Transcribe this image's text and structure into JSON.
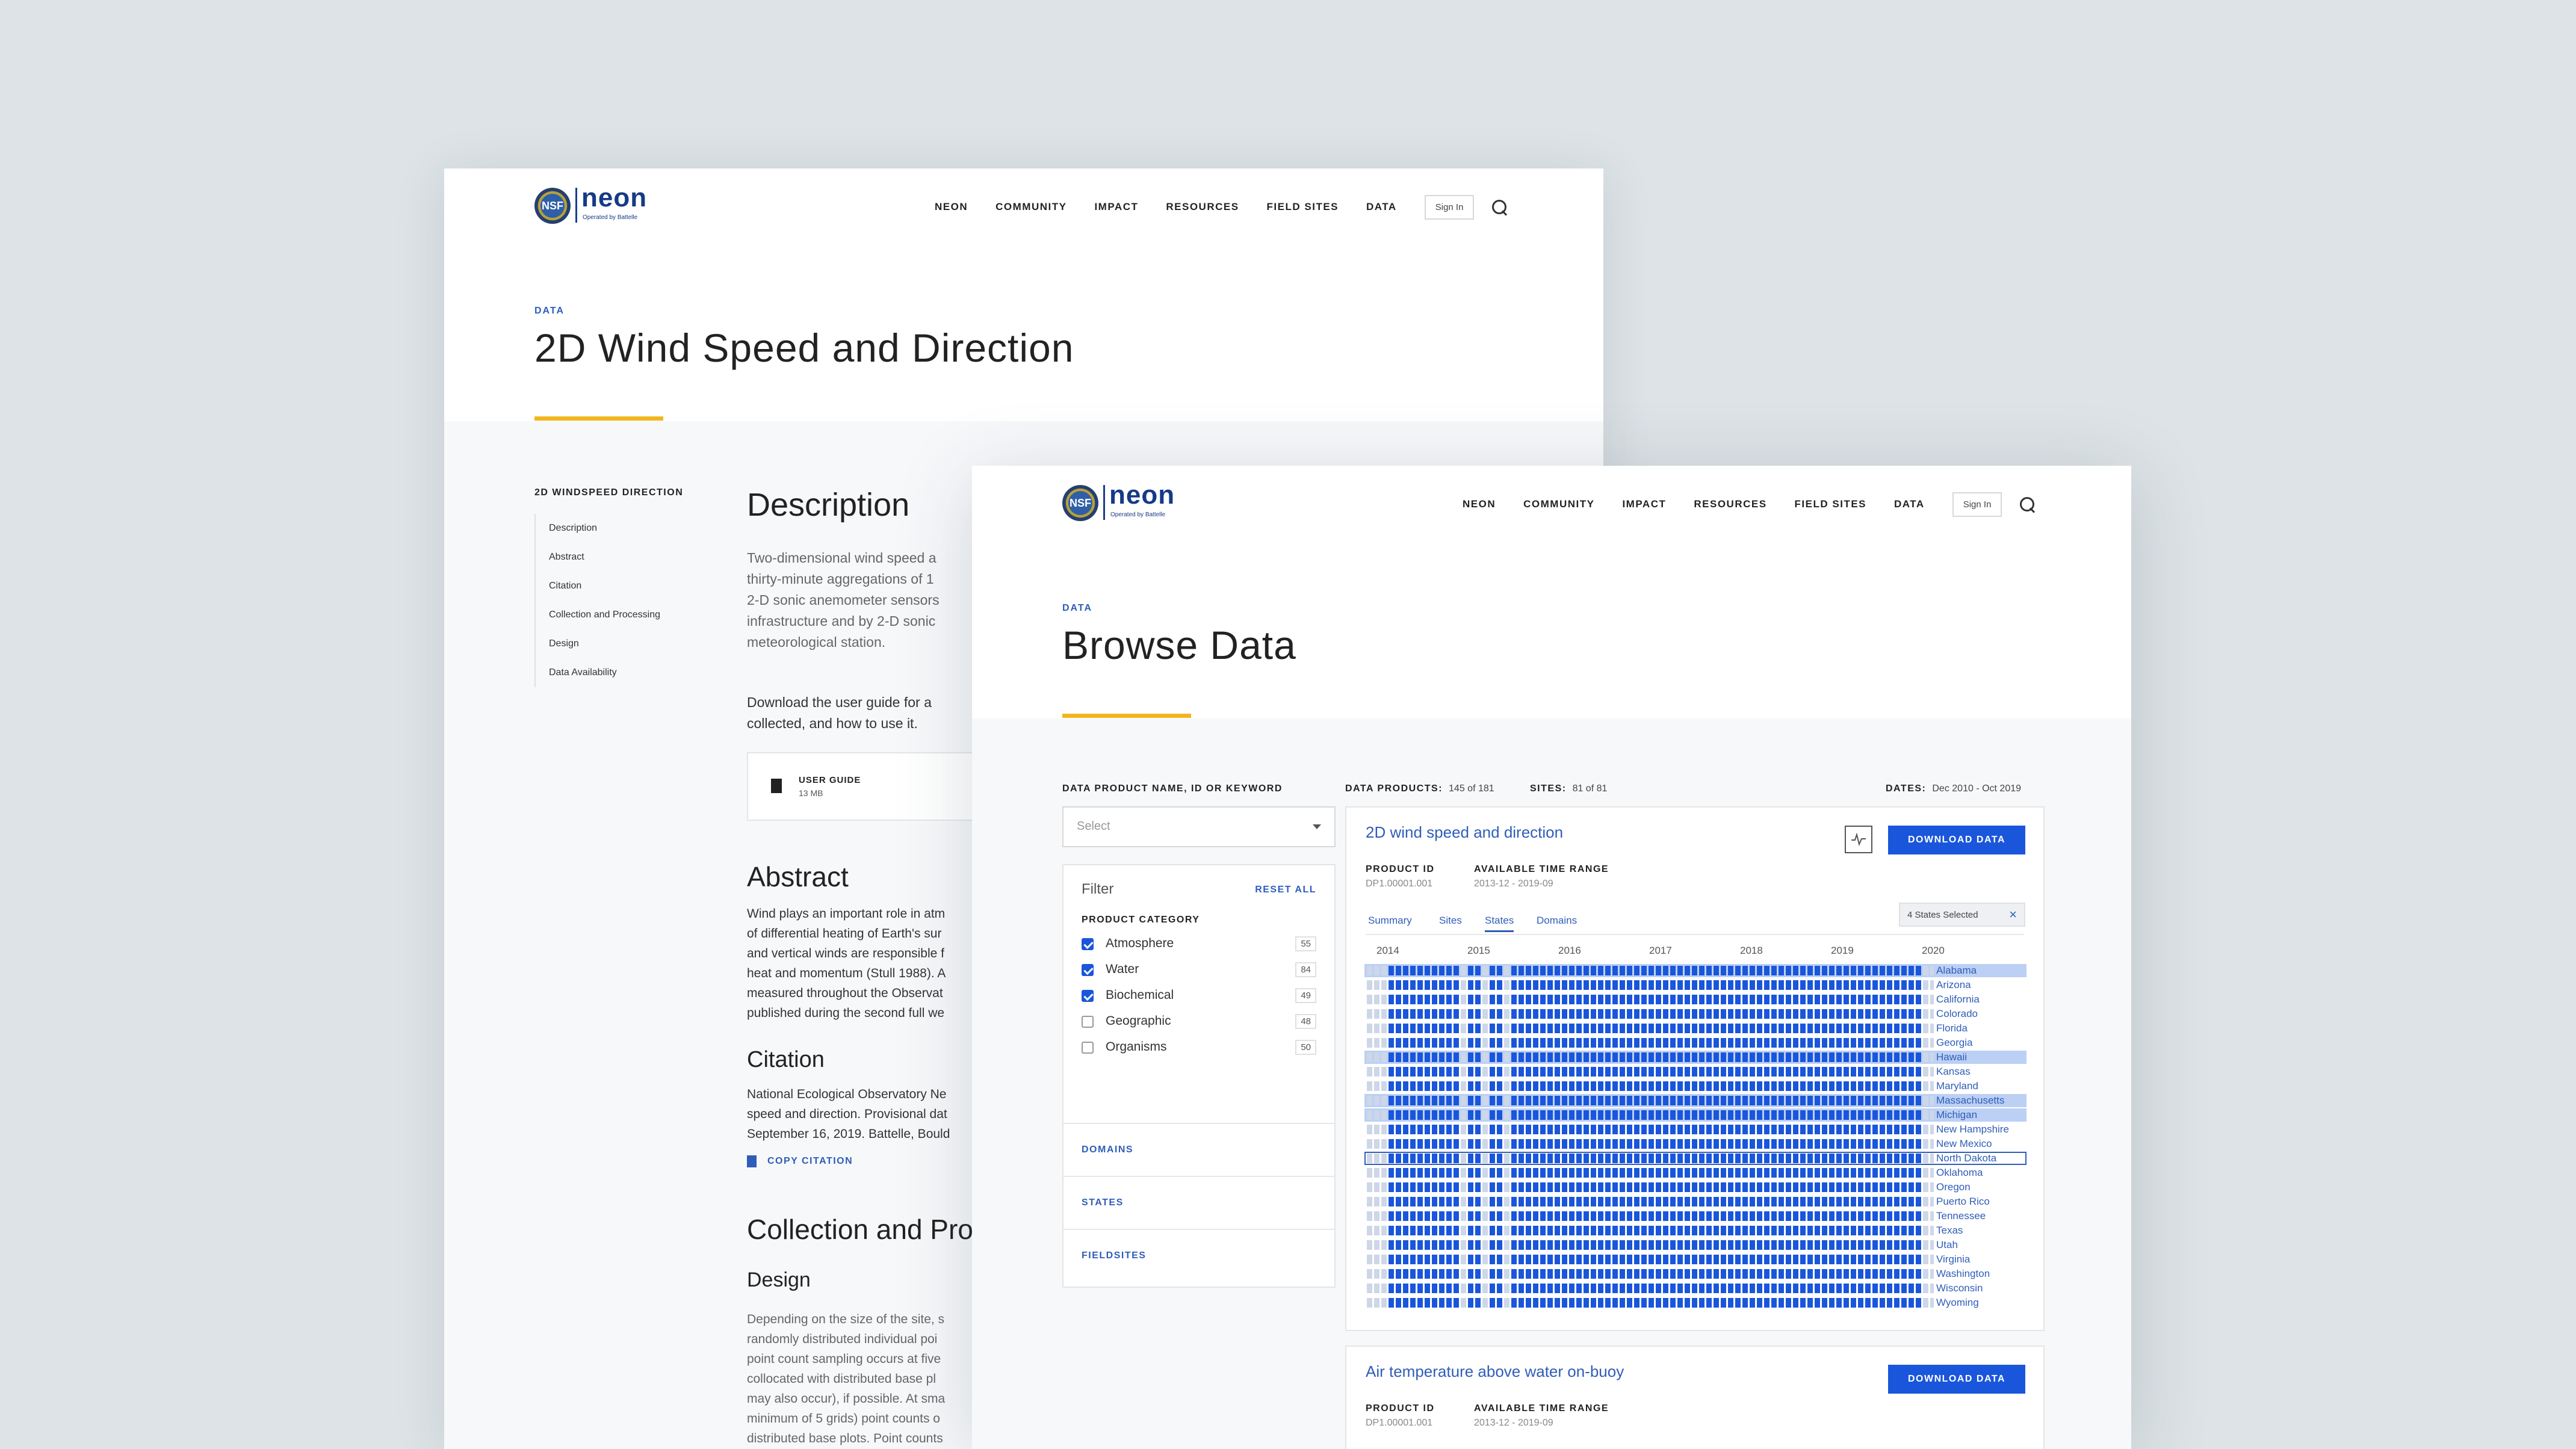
{
  "nav": {
    "logo_text": "neon",
    "logo_tagline": "Operated by Battelle",
    "nsf_text": "NSF",
    "items": [
      "NEON",
      "COMMUNITY",
      "IMPACT",
      "RESOURCES",
      "FIELD SITES",
      "DATA"
    ],
    "sign_in": "Sign In"
  },
  "back_page": {
    "kicker": "DATA",
    "title": "2D Wind Speed and Direction",
    "toc_title": "2D WINDSPEED DIRECTION",
    "toc": [
      "Description",
      "Abstract",
      "Citation",
      "Collection and Processing",
      "Design",
      "Data Availability"
    ],
    "description_title": "Description",
    "description_lines": [
      "Two-dimensional wind speed a",
      "thirty-minute aggregations of 1",
      "2-D sonic anemometer sensors",
      "infrastructure and by 2-D sonic",
      "meteorological station."
    ],
    "download_text_lines": [
      "Download the user guide for a",
      "collected, and how to use it."
    ],
    "user_guide_label": "USER GUIDE",
    "user_guide_size": "13 MB",
    "abstract_title": "Abstract",
    "abstract_lines": [
      "Wind plays an important role in atm",
      "of differential heating of Earth's sur",
      "and vertical winds are responsible f",
      "heat and momentum (Stull 1988). A",
      "measured throughout the Observat",
      "published during the second full we"
    ],
    "citation_title": "Citation",
    "citation_lines": [
      "National Ecological Observatory Ne",
      "speed and direction. Provisional dat",
      "September 16, 2019. Battelle, Bould"
    ],
    "copy_citation": "COPY CITATION",
    "collection_title": "Collection and Pro",
    "design_title": "Design",
    "design_lines": [
      "Depending on the size of the site, s",
      "randomly distributed individual poi",
      "point count sampling occurs at five",
      "collocated with distributed base pl",
      "may also occur), if possible. At sma",
      "minimum of 5 grids) point counts o",
      "distributed base plots. Point counts"
    ]
  },
  "front_page": {
    "kicker": "DATA",
    "title": "Browse Data",
    "search_label": "DATA PRODUCT NAME, ID OR KEYWORD",
    "search_placeholder": "Select",
    "data_products_label": "DATA PRODUCTS:",
    "data_products_value": "145 of 181",
    "sites_label": "SITES:",
    "sites_value": "81 of 81",
    "dates_label": "DATES:",
    "dates_value": "Dec 2010 - Oct 2019",
    "filter": {
      "title": "Filter",
      "reset": "RESET ALL",
      "category_label": "PRODUCT CATEGORY",
      "categories": [
        {
          "label": "Atmosphere",
          "count": "55",
          "checked": true
        },
        {
          "label": "Water",
          "count": "84",
          "checked": true
        },
        {
          "label": "Biochemical",
          "count": "49",
          "checked": true
        },
        {
          "label": "Geographic",
          "count": "48",
          "checked": false
        },
        {
          "label": "Organisms",
          "count": "50",
          "checked": false
        }
      ],
      "sections": [
        "DOMAINS",
        "STATES",
        "FIELDSITES"
      ]
    },
    "products": [
      {
        "name": "2D wind speed and direction",
        "download": "DOWNLOAD DATA",
        "id_label": "PRODUCT ID",
        "id_value": "DP1.00001.001",
        "range_label": "AVAILABLE TIME RANGE",
        "range_value": "2013-12 - 2019-09",
        "tabs": [
          "Summary",
          "Sites",
          "States",
          "Domains"
        ],
        "active_tab": "States",
        "chip": "4 States Selected",
        "chip_close": "×",
        "years": [
          "2014",
          "2015",
          "2016",
          "2017",
          "2018",
          "2019",
          "2020"
        ],
        "states": [
          "Alabama",
          "Arizona",
          "California",
          "Colorado",
          "Florida",
          "Georgia",
          "Hawaii",
          "Kansas",
          "Maryland",
          "Massachusetts",
          "Michigan",
          "New Hampshire",
          "New Mexico",
          "North Dakota",
          "Oklahoma",
          "Oregon",
          "Puerto Rico",
          "Tennessee",
          "Texas",
          "Utah",
          "Virginia",
          "Washington",
          "Wisconsin",
          "Wyoming"
        ],
        "highlighted_states": [
          "Alabama",
          "Hawaii",
          "Massachusetts",
          "Michigan"
        ],
        "outlined_state": "North Dakota"
      },
      {
        "name": "Air temperature above water on-buoy",
        "download": "DOWNLOAD DATA",
        "id_label": "PRODUCT ID",
        "id_value": "DP1.00001.001",
        "range_label": "AVAILABLE TIME RANGE",
        "range_value": "2013-12 - 2019-09"
      }
    ],
    "colors": {
      "accent": "#1a56db",
      "link": "#2f5db8",
      "underline": "#f2b51f",
      "highlight": "#bcd0f5"
    }
  }
}
